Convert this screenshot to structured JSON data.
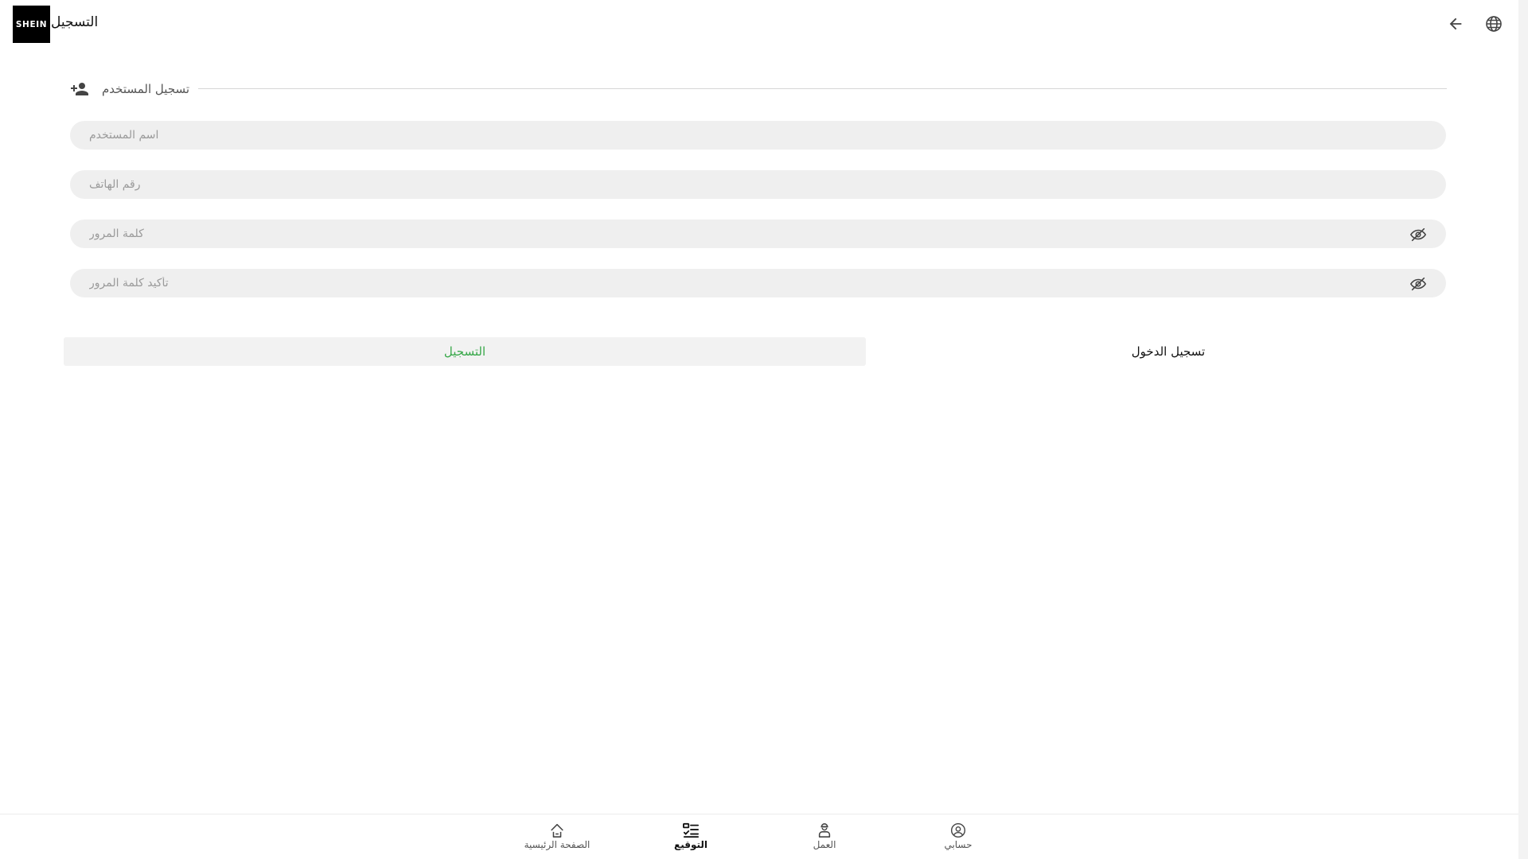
{
  "header": {
    "logo_text": "SHEIN",
    "title": "التسجيل",
    "back_icon": "arrow-back-icon",
    "language_icon": "globe-icon"
  },
  "section": {
    "label": "تسجيل المستخدم",
    "icon": "person-add-icon"
  },
  "form": {
    "username_placeholder": "اسم المستخدم",
    "username_value": "",
    "phone_placeholder": "رقم الهاتف",
    "phone_value": "",
    "password_placeholder": "كلمة المرور",
    "password_value": "",
    "confirm_placeholder": "تأكيد كلمة المرور",
    "confirm_value": ""
  },
  "buttons": {
    "register_label": "التسجيل",
    "login_label": "تسجيل الدخول"
  },
  "colors": {
    "accent_green": "#38a84a",
    "input_background": "#efefef",
    "logo_background": "#000000"
  },
  "bottom_nav": {
    "items": [
      {
        "label": "الصفحة الرئيسية",
        "icon": "home-icon",
        "active": false
      },
      {
        "label": "التوقيع",
        "icon": "checklist-icon",
        "active": true
      },
      {
        "label": "العمل",
        "icon": "worker-icon",
        "active": false
      },
      {
        "label": "حسابي",
        "icon": "account-icon",
        "active": false
      }
    ]
  }
}
